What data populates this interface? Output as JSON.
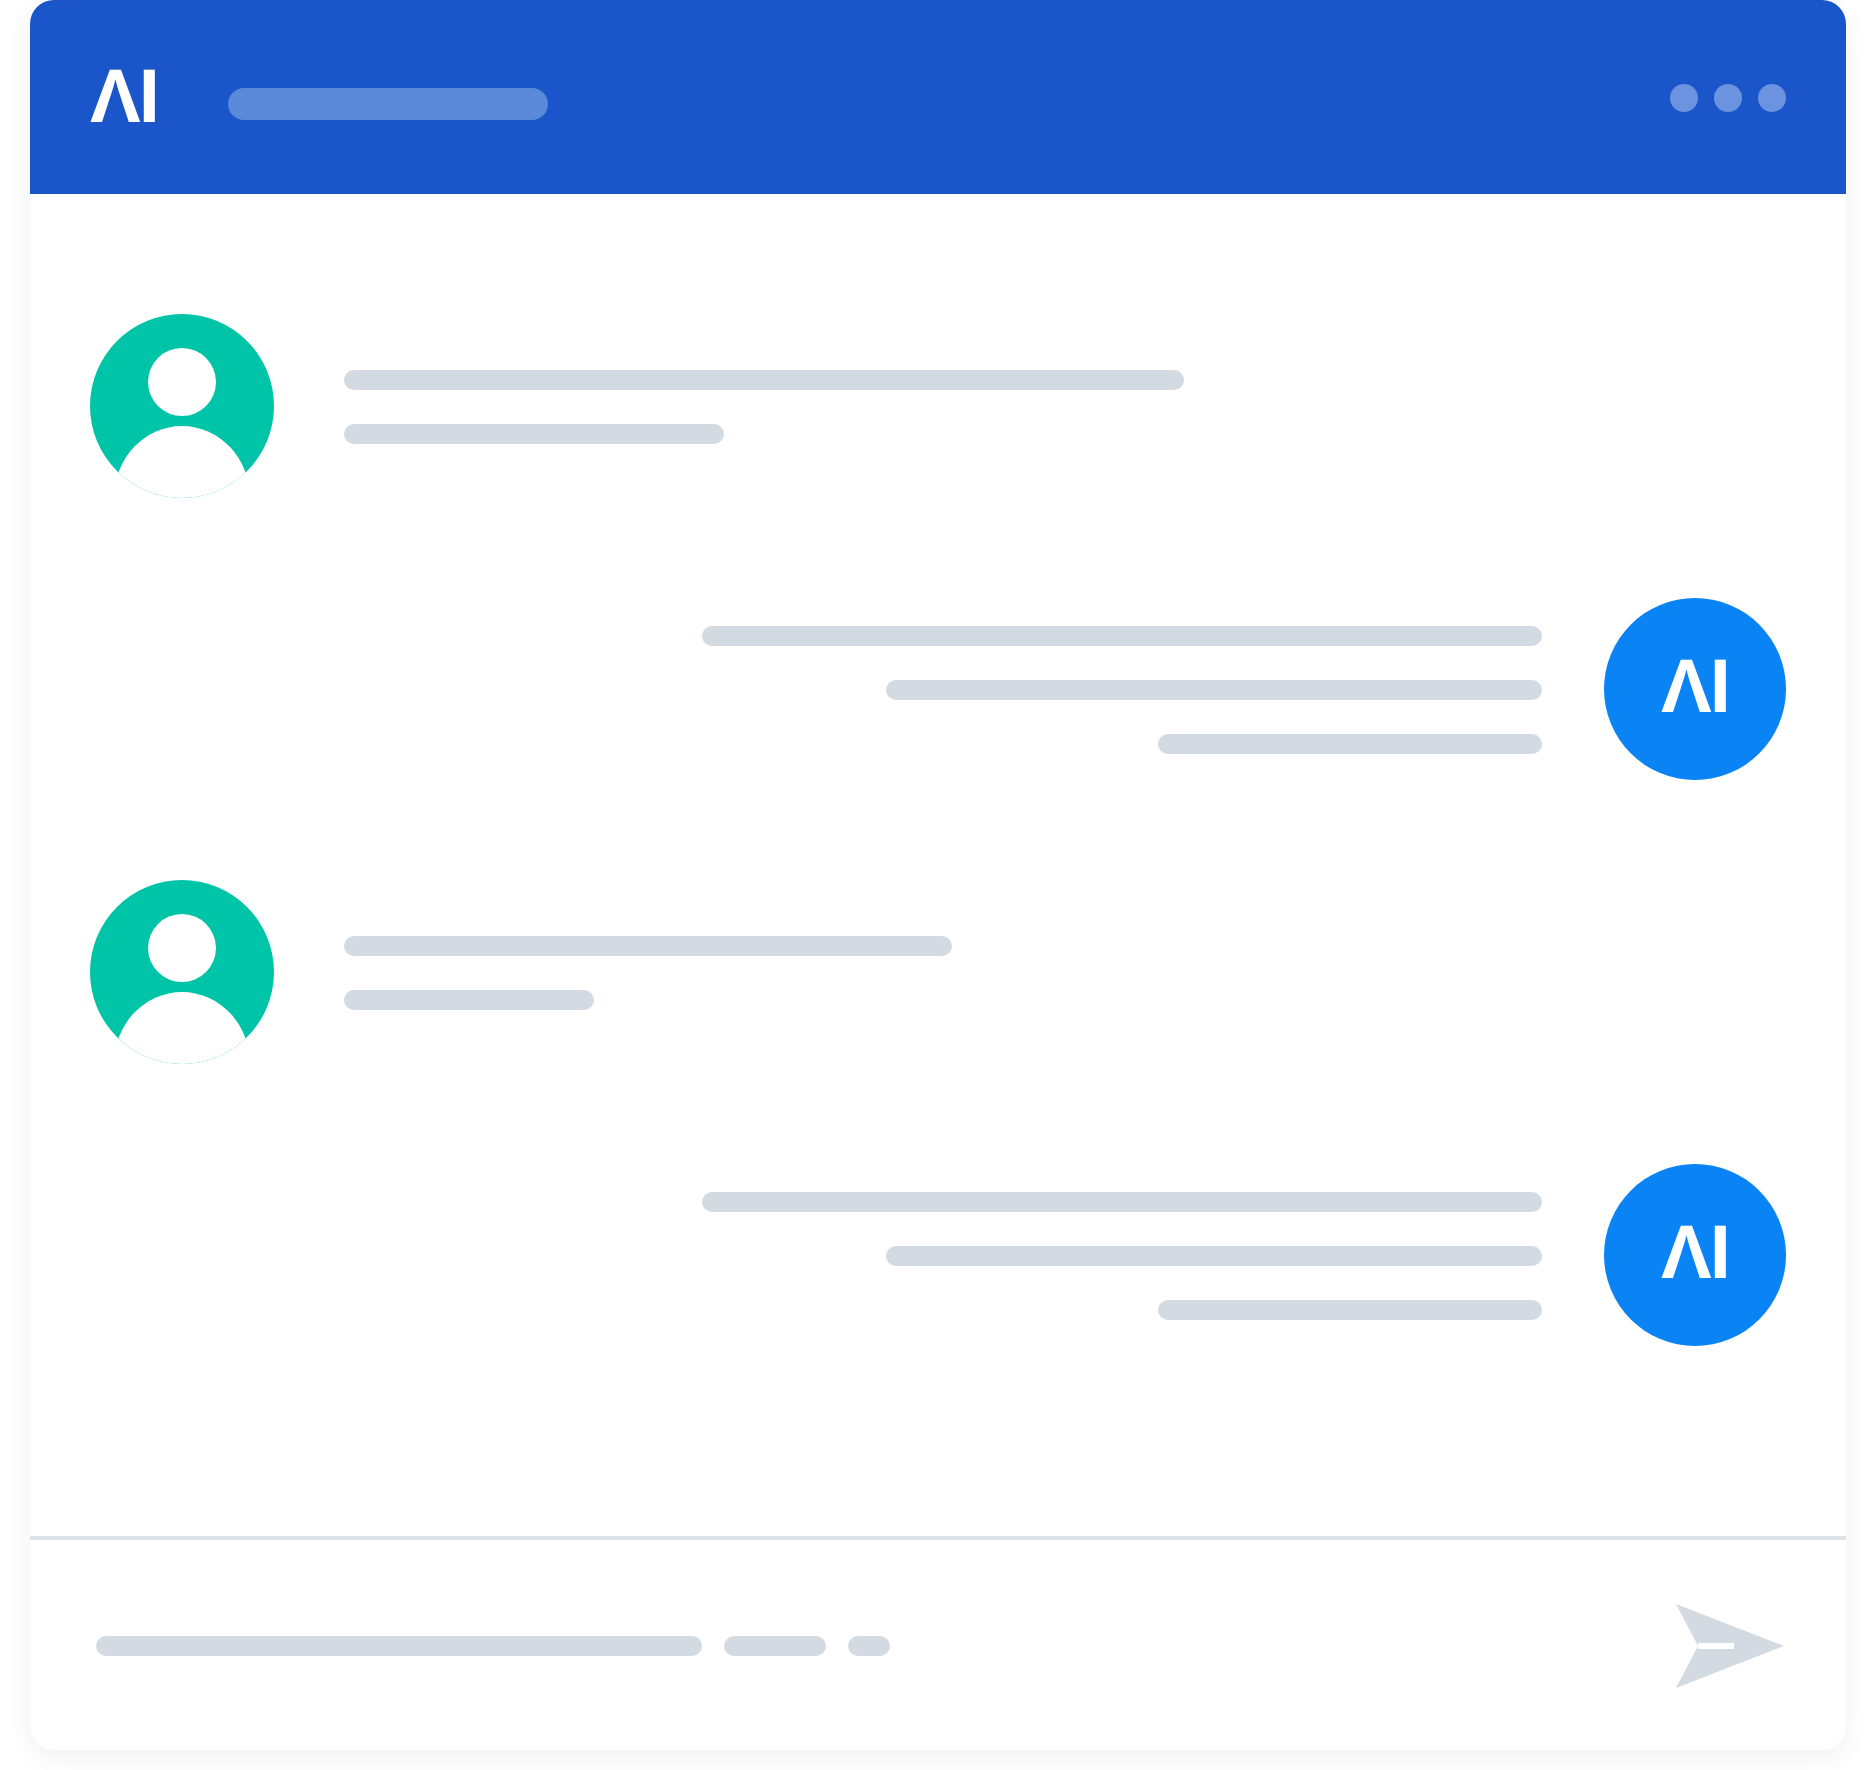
{
  "header": {
    "logo": "ΛI"
  },
  "messages": [
    {
      "kind": "user"
    },
    {
      "kind": "bot",
      "logo": "ΛI"
    },
    {
      "kind": "user"
    },
    {
      "kind": "bot",
      "logo": "ΛI"
    }
  ]
}
